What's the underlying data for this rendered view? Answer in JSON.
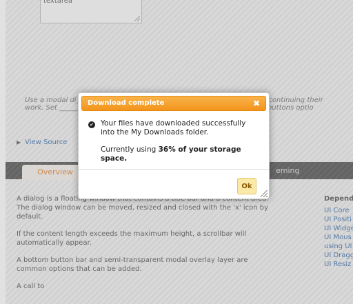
{
  "demo": {
    "textarea_text": "textarea"
  },
  "description": {
    "text": "Use a modal di________________________________________________ before continuing their work. Set ______________________________________________ (Ok) with the buttons optio"
  },
  "view_source": {
    "label": "View Source"
  },
  "tabs": {
    "overview": "Overview",
    "theming": "eming"
  },
  "content": {
    "paragraphs": [
      "A dialog is a floating window that contains a title bar and a content area. The dialog window can be moved, resized and closed with the 'x' icon by default.",
      "If the content length exceeds the maximum height, a scrollbar will automatically appear.",
      "A bottom button bar and semi-transparent modal overlay layer are common options that can be added.",
      "A call to"
    ]
  },
  "dependencies": {
    "title": "Depend",
    "items": [
      "UI Core",
      "UI Positi",
      "UI Widge",
      "UI Mous",
      "using UI",
      "UI Dragg",
      "UI Resiz"
    ]
  },
  "dialog": {
    "title": "Download complete",
    "close_symbol": "✖",
    "message_line1": "Your files have downloaded successfully into the My Downloads folder.",
    "message_line2_prefix": "Currently using ",
    "message_line2_bold": "36% of your storage space.",
    "ok_label": "Ok"
  },
  "colors": {
    "accent": "#f3941c",
    "link": "#2a63a8"
  }
}
